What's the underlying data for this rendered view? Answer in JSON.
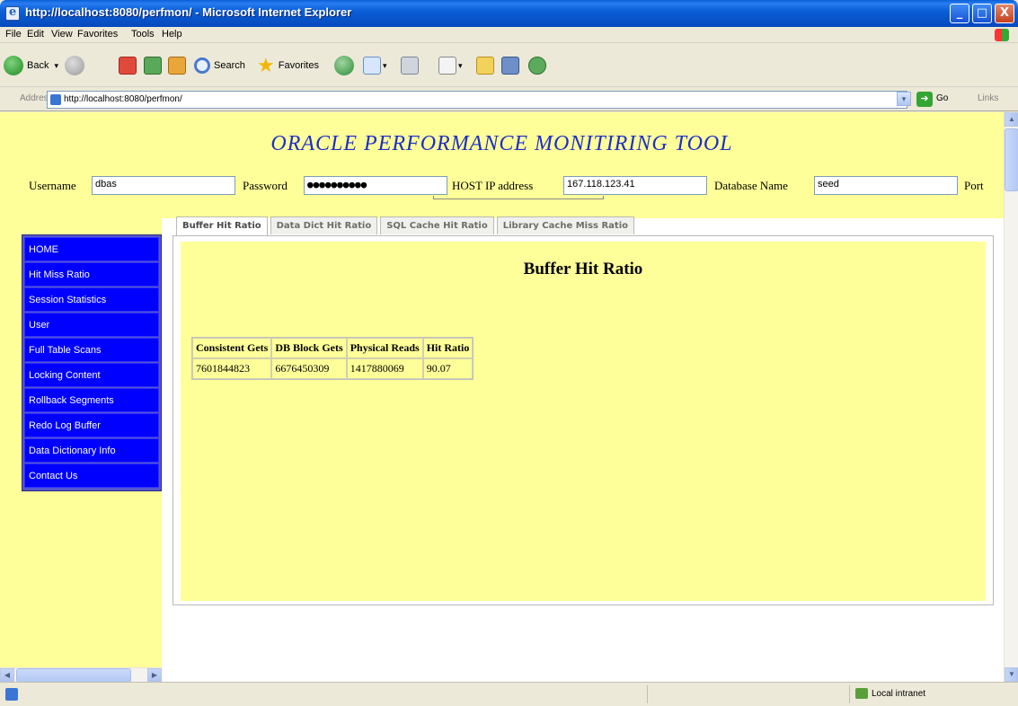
{
  "window": {
    "title": "http://localhost:8080/perfmon/ - Microsoft Internet Explorer",
    "minimize_glyph": "_",
    "maximize_glyph": "□",
    "close_glyph": "X"
  },
  "menubar": {
    "items": [
      "File",
      "Edit",
      "View",
      "Favorites",
      "Tools",
      "Help"
    ]
  },
  "toolbar": {
    "back_label": "Back",
    "search_label": "Search",
    "favorites_label": "Favorites",
    "dropdown_glyph": "▾"
  },
  "addressbar": {
    "label": "Address",
    "url": "http://localhost:8080/perfmon/",
    "go_label": "Go",
    "links_label": "Links"
  },
  "header": {
    "app_title": "ORACLE PERFORMANCE MONITIRING TOOL",
    "fields": {
      "username": {
        "label": "Username",
        "value": "dbas"
      },
      "password": {
        "label": "Password",
        "value": "●●●●●●●●●●"
      },
      "host": {
        "label": "HOST IP address",
        "value": "167.118.123.41"
      },
      "database": {
        "label": "Database Name",
        "value": "seed"
      },
      "port": {
        "label": "Port"
      }
    }
  },
  "nav": {
    "items": [
      "HOME",
      "Hit Miss Ratio",
      "Session Statistics",
      "User",
      "Full Table Scans",
      "Locking Content",
      "Rollback Segments",
      "Redo Log Buffer",
      "Data Dictionary Info",
      "Contact Us"
    ]
  },
  "tabs": [
    {
      "label": "Buffer Hit Ratio",
      "active": true
    },
    {
      "label": "Data Dict Hit Ratio",
      "active": false
    },
    {
      "label": "SQL Cache Hit Ratio",
      "active": false
    },
    {
      "label": "Library Cache Miss Ratio",
      "active": false
    }
  ],
  "panel": {
    "title": "Buffer Hit Ratio",
    "table": {
      "headers": [
        "Consistent Gets",
        "DB Block Gets",
        "Physical Reads",
        "Hit Ratio"
      ],
      "rows": [
        [
          "7601844823",
          "6676450309",
          "1417880069",
          "90.07"
        ]
      ]
    }
  },
  "statusbar": {
    "zone": "Local intranet"
  },
  "scroll": {
    "up_glyph": "▲",
    "down_glyph": "▼",
    "left_glyph": "◀",
    "right_glyph": "▶"
  },
  "colors": {
    "page_background": "#ffff99",
    "title_blue": "#1c2ec8",
    "nav_blue": "#0000ff"
  }
}
